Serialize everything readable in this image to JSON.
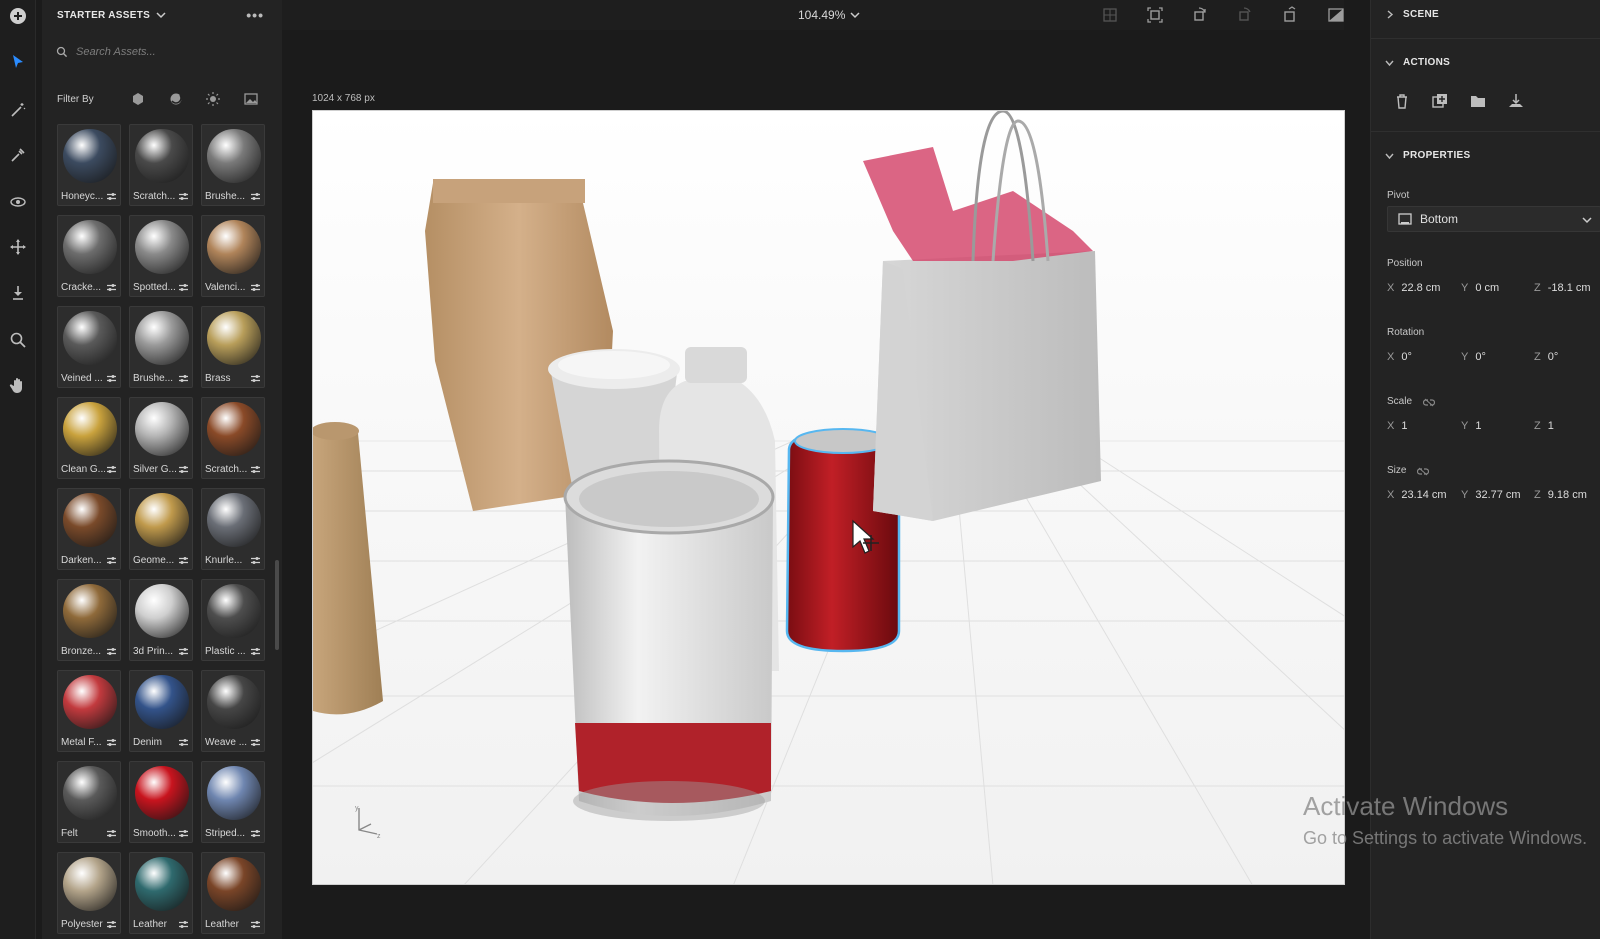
{
  "toolbar": {
    "tools": [
      {
        "name": "add-icon"
      },
      {
        "name": "select-icon"
      },
      {
        "name": "magic-wand-icon"
      },
      {
        "name": "eyedropper-icon"
      },
      {
        "name": "orbit-icon"
      },
      {
        "name": "move-icon"
      },
      {
        "name": "drop-to-ground-icon"
      },
      {
        "name": "zoom-icon"
      },
      {
        "name": "pan-hand-icon"
      }
    ]
  },
  "assets": {
    "title": "STARTER ASSETS",
    "search_placeholder": "Search Assets...",
    "filter_label": "Filter By",
    "materials": [
      {
        "label": "Honeyc...",
        "color": "#3c4b60"
      },
      {
        "label": "Scratch...",
        "color": "#4a4a4a"
      },
      {
        "label": "Brushe...",
        "color": "#7a7a7a"
      },
      {
        "label": "Cracke...",
        "color": "#6d6d6d"
      },
      {
        "label": "Spotted...",
        "color": "#8a8a8a"
      },
      {
        "label": "Valenci...",
        "color": "#b0845a"
      },
      {
        "label": "Veined ...",
        "color": "#5a5a5a"
      },
      {
        "label": "Brushe...",
        "color": "#9a9a9a"
      },
      {
        "label": "Brass",
        "color": "#b89e5a"
      },
      {
        "label": "Clean G...",
        "color": "#c9a23d"
      },
      {
        "label": "Silver G...",
        "color": "#b5b5b5"
      },
      {
        "label": "Scratch...",
        "color": "#8a4a28"
      },
      {
        "label": "Darken...",
        "color": "#7a4a2a"
      },
      {
        "label": "Geome...",
        "color": "#c09a4c"
      },
      {
        "label": "Knurle...",
        "color": "#6a6e76"
      },
      {
        "label": "Bronze...",
        "color": "#8f6a3a"
      },
      {
        "label": "3d Prin...",
        "color": "#cfcfcf"
      },
      {
        "label": "Plastic ...",
        "color": "#4e4e4e"
      },
      {
        "label": "Metal F...",
        "color": "#c23a3e"
      },
      {
        "label": "Denim",
        "color": "#33538a"
      },
      {
        "label": "Weave ...",
        "color": "#464646"
      },
      {
        "label": "Felt",
        "color": "#5a5a5a"
      },
      {
        "label": "Smooth...",
        "color": "#c8141e"
      },
      {
        "label": "Striped...",
        "color": "#6f86b0"
      },
      {
        "label": "Polyester",
        "color": "#b3a48a"
      },
      {
        "label": "Leather",
        "color": "#2f6a6e"
      },
      {
        "label": "Leather",
        "color": "#7a4528"
      }
    ]
  },
  "topbar": {
    "zoom": "104.49%"
  },
  "viewport": {
    "dimensions": "1024 x 768 px"
  },
  "panel": {
    "scene_label": "SCENE",
    "actions_label": "ACTIONS",
    "properties_label": "PROPERTIES",
    "pivot": {
      "label": "Pivot",
      "value": "Bottom"
    },
    "position": {
      "label": "Position",
      "x": "22.8 cm",
      "y": "0 cm",
      "z": "-18.1 cm"
    },
    "rotation": {
      "label": "Rotation",
      "x": "0°",
      "y": "0°",
      "z": "0°"
    },
    "scale": {
      "label": "Scale",
      "x": "1",
      "y": "1",
      "z": "1"
    },
    "size": {
      "label": "Size",
      "x": "23.14 cm",
      "y": "32.77 cm",
      "z": "9.18 cm"
    },
    "axis_x": "X",
    "axis_y": "Y",
    "axis_z": "Z"
  },
  "watermark": {
    "line1": "Activate Windows",
    "line2": "Go to Settings to activate Windows."
  }
}
